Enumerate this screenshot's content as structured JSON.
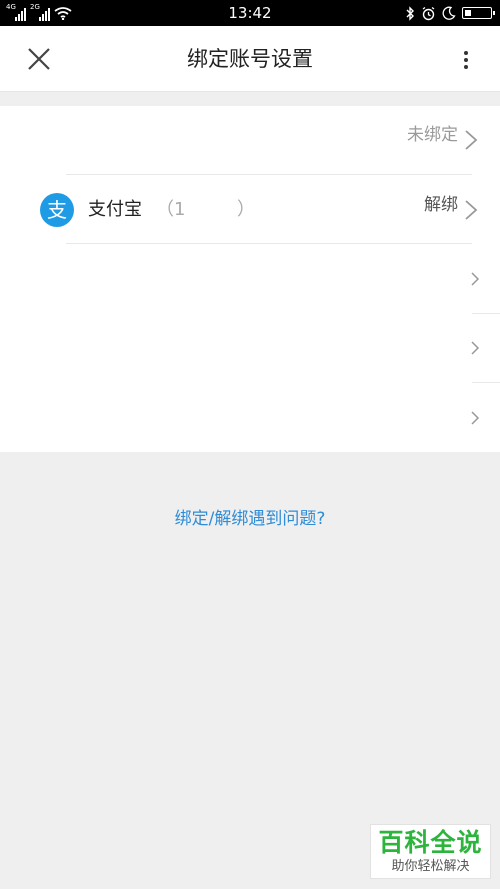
{
  "status_bar": {
    "time": "13:42",
    "signal1_label": "4G",
    "signal2_label": "2G",
    "icons": [
      "signal-icon",
      "wifi-icon",
      "bluetooth-icon",
      "alarm-icon",
      "moon-icon",
      "battery-icon"
    ],
    "battery_level": 0.25
  },
  "header": {
    "title": "绑定账号设置"
  },
  "rows": [
    {
      "status": "未绑定"
    },
    {
      "name": "支付宝",
      "account": "（1         ）",
      "status": "解绑",
      "icon_glyph": "支",
      "icon_color": "#1f9be6"
    },
    {},
    {},
    {}
  ],
  "help_link": "绑定/解绑遇到问题?",
  "watermark": {
    "line1": "百科全说",
    "line2": "助你轻松解决"
  },
  "colors": {
    "accent_link": "#2f8cd6",
    "background": "#efefef"
  }
}
